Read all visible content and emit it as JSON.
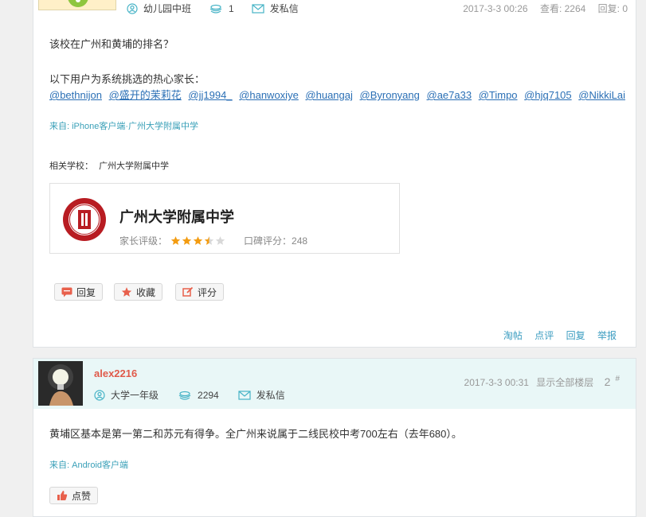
{
  "post1": {
    "author_level": "幼儿园中班",
    "points": "1",
    "message_label": "发私信",
    "date": "2017-3-3 00:26",
    "views": "查看: 2264",
    "replies": "回复: 0",
    "question": "该校在广州和黄埔的排名？",
    "recommend_label": "以下用户为系统挑选的热心家长：",
    "mentions": [
      "@bethnijon",
      "@盛开的茉莉花",
      "@jj1994_",
      "@hanwoxiye",
      "@huangaj",
      "@Byronyang",
      "@ae7a33",
      "@Timpo",
      "@hjq7105",
      "@NikkiLai"
    ],
    "source": "来自: iPhone客户端·广州大学附属中学",
    "related_label": "相关学校：",
    "related_school": "广州大学附属中学",
    "school_card": {
      "name": "广州大学附属中学",
      "rating_label": "家长评级：",
      "stars": 3.5,
      "review_label": "口碑评分：248"
    },
    "buttons": {
      "reply": "回复",
      "favorite": "收藏",
      "rate": "评分"
    },
    "actions": [
      "淘帖",
      "点评",
      "回复",
      "举报"
    ]
  },
  "post2": {
    "username": "alex2216",
    "author_level": "大学一年级",
    "points": "2294",
    "message_label": "发私信",
    "date": "2017-3-3 00:31",
    "show_all": "显示全部楼层",
    "floor": "2",
    "floor_mark": "#",
    "content": "黄埔区基本是第一第二和苏元有得争。全广州来说属于二线民校中考700左右（去年680）。",
    "source": "来自: Android客户端",
    "like_label": "点赞"
  },
  "colors": {
    "link": "#2a6fb5",
    "source": "#3aa0b8",
    "username": "#e05a4a",
    "star": "#f39c12",
    "header_bg": "#e9f7f7"
  }
}
